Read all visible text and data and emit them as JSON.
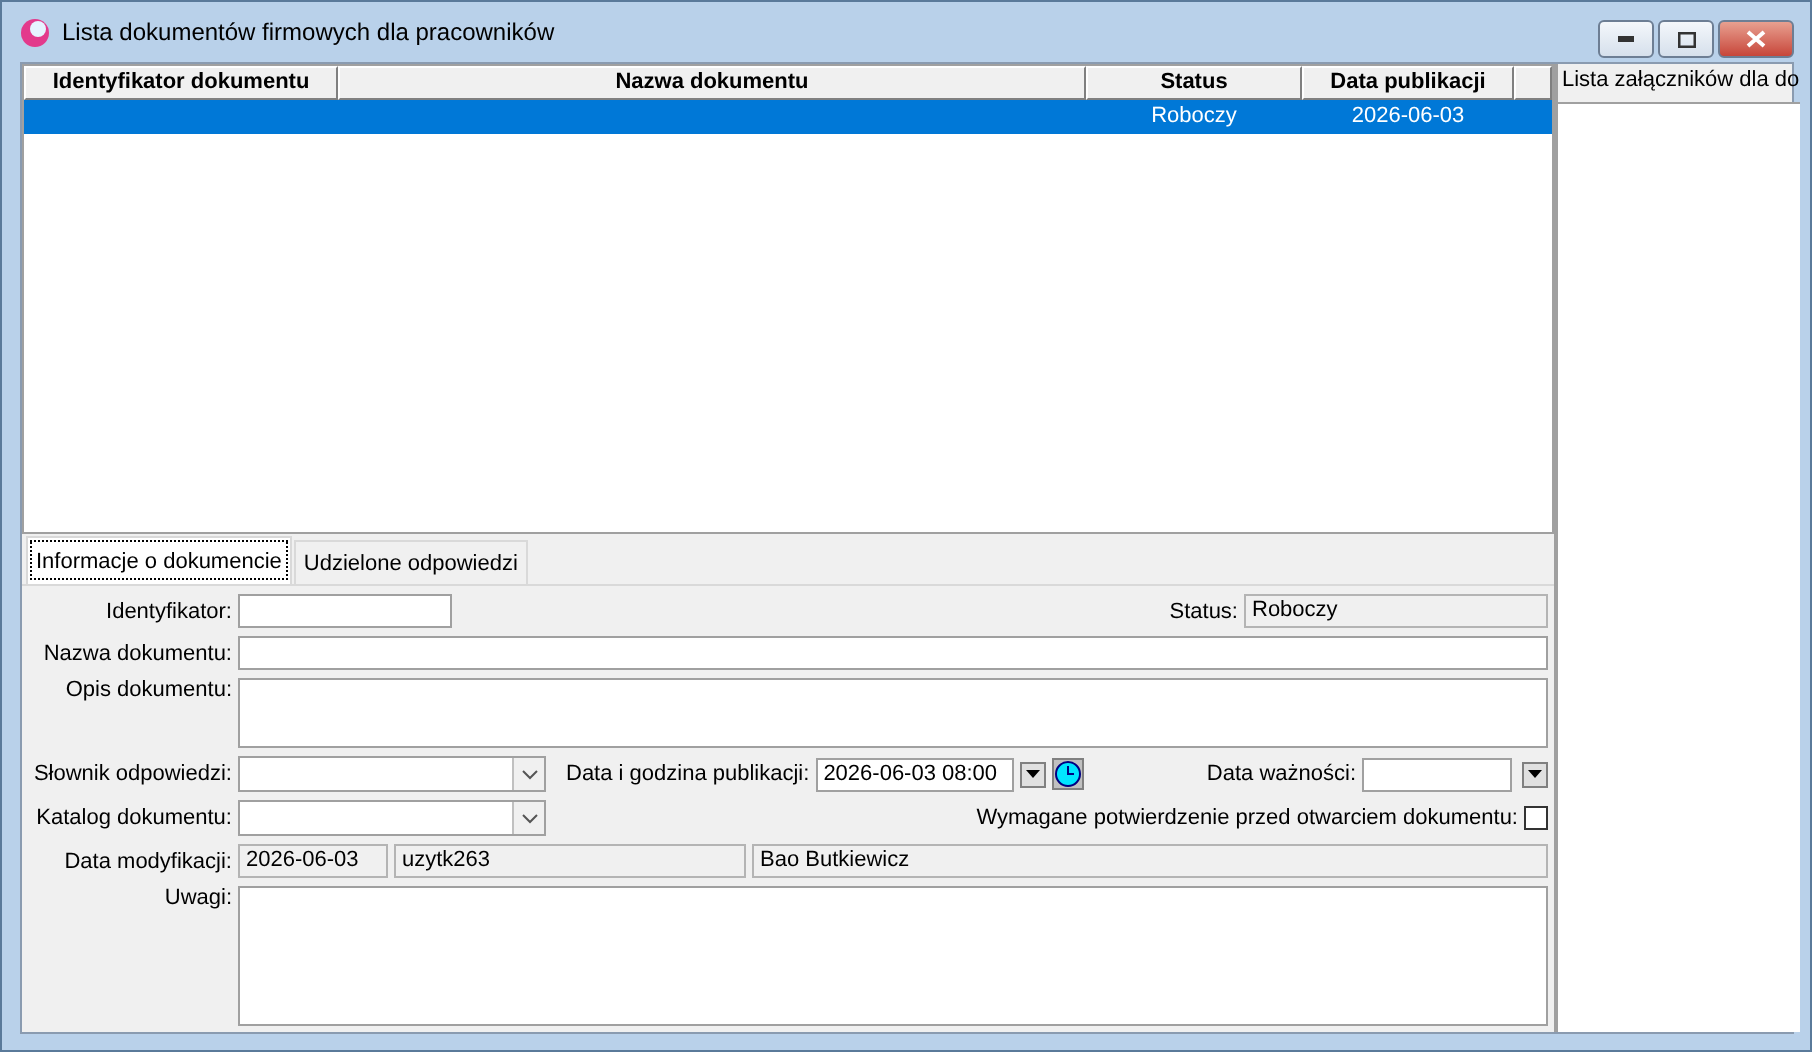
{
  "window": {
    "title": "Lista dokumentów firmowych dla pracowników"
  },
  "table": {
    "columns": [
      "Identyfikator dokumentu",
      "Nazwa dokumentu",
      "Status",
      "Data publikacji"
    ],
    "rows": [
      {
        "status": "Roboczy",
        "date": "2026-06-03",
        "selected": true
      }
    ]
  },
  "attachments": {
    "title": "Lista załączników dla do"
  },
  "tabs": [
    {
      "label": "Informacje o dokumencie",
      "selected": true
    },
    {
      "label": "Udzielone odpowiedzi",
      "selected": false
    }
  ],
  "form": {
    "id_label": "Identyfikator:",
    "status_label": "Status:",
    "status_value": "Roboczy",
    "name_label": "Nazwa dokumentu:",
    "desc_label": "Opis dokumentu:",
    "dict_label": "Słownik odpowiedzi:",
    "pub_label": "Data i godzina publikacji:",
    "pub_value": "2026-06-03 08:00",
    "valid_label": "Data ważności:",
    "catalog_label": "Katalog dokumentu:",
    "confirm_label": "Wymagane potwierdzenie przed otwarciem dokumentu:",
    "confirm_checked": false,
    "mod_label": "Data modyfikacji:",
    "mod_date": "2026-06-03",
    "mod_user": "uzytk263",
    "mod_name": "Bao Butkiewicz",
    "notes_label": "Uwagi:"
  }
}
